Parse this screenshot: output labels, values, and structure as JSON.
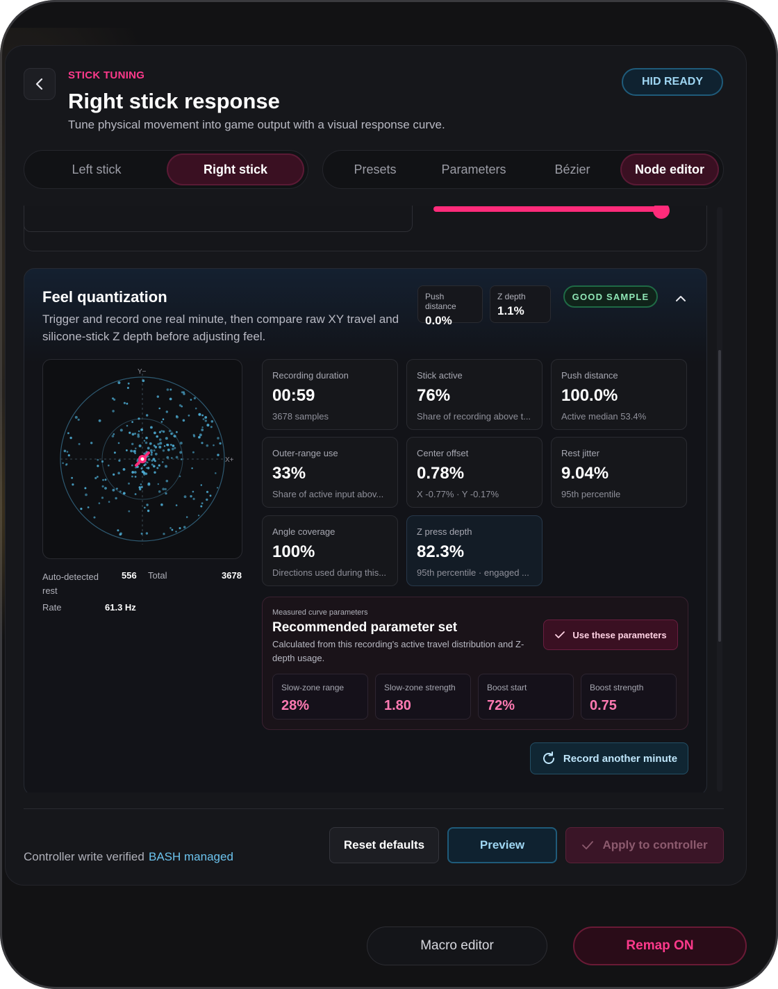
{
  "header": {
    "kicker": "STICK TUNING",
    "title": "Right stick response",
    "subtitle": "Tune physical movement into game output with a visual response curve.",
    "status_badge": "HID READY"
  },
  "stick_tabs": [
    {
      "label": "Left stick",
      "active": false
    },
    {
      "label": "Right stick",
      "active": true
    }
  ],
  "mode_tabs": [
    {
      "label": "Presets",
      "active": false
    },
    {
      "label": "Parameters",
      "active": false
    },
    {
      "label": "Bézier",
      "active": false
    },
    {
      "label": "Node editor",
      "active": true
    }
  ],
  "feel_quantization": {
    "title": "Feel quantization",
    "description": "Trigger and record one real minute, then compare raw XY travel and silicone-stick Z depth before adjusting feel.",
    "push_distance_label": "Push distance",
    "push_distance_value": "0.0%",
    "z_depth_label": "Z depth",
    "z_depth_value": "1.1%",
    "sample_badge": "GOOD SAMPLE",
    "plot": {
      "y_label": "Y−",
      "x_label": "X+"
    },
    "rest_label": "Auto-detected rest",
    "rest_value": "556",
    "total_label": "Total",
    "total_value": "3678",
    "rate_label": "Rate",
    "rate_value": "61.3 Hz",
    "stats": [
      {
        "label": "Recording duration",
        "value": "00:59",
        "sub": "3678 samples",
        "highlight": false
      },
      {
        "label": "Stick active",
        "value": "76%",
        "sub": "Share of recording above t...",
        "highlight": false
      },
      {
        "label": "Push distance",
        "value": "100.0%",
        "sub": "Active median 53.4%",
        "highlight": false
      },
      {
        "label": "Outer-range use",
        "value": "33%",
        "sub": "Share of active input abov...",
        "highlight": false
      },
      {
        "label": "Center offset",
        "value": "0.78%",
        "sub": "X -0.77% · Y -0.17%",
        "highlight": false
      },
      {
        "label": "Rest jitter",
        "value": "9.04%",
        "sub": "95th percentile",
        "highlight": false
      },
      {
        "label": "Angle coverage",
        "value": "100%",
        "sub": "Directions used during this...",
        "highlight": false
      },
      {
        "label": "Z press depth",
        "value": "82.3%",
        "sub": "95th percentile · engaged ...",
        "highlight": true
      }
    ],
    "recommendation": {
      "kicker": "Measured curve parameters",
      "title": "Recommended parameter set",
      "description": "Calculated from this recording's active travel distribution and Z-depth usage.",
      "use_button": "Use these parameters",
      "params": [
        {
          "label": "Slow-zone range",
          "value": "28%"
        },
        {
          "label": "Slow-zone strength",
          "value": "1.80"
        },
        {
          "label": "Boost start",
          "value": "72%"
        },
        {
          "label": "Boost strength",
          "value": "0.75"
        }
      ]
    },
    "record_button": "Record another minute"
  },
  "footer": {
    "status_text": "Controller write verified",
    "status_link": "BASH managed",
    "reset_button": "Reset defaults",
    "preview_button": "Preview",
    "apply_button": "Apply to controller"
  },
  "bottom_bar": {
    "macro_button": "Macro editor",
    "remap_button": "Remap ON"
  },
  "colors": {
    "accent_pink": "#ff3a8c",
    "accent_blue": "#6cc3ee",
    "good_green": "#8fe6b5",
    "scatter_dot": "#4fb0d8"
  }
}
